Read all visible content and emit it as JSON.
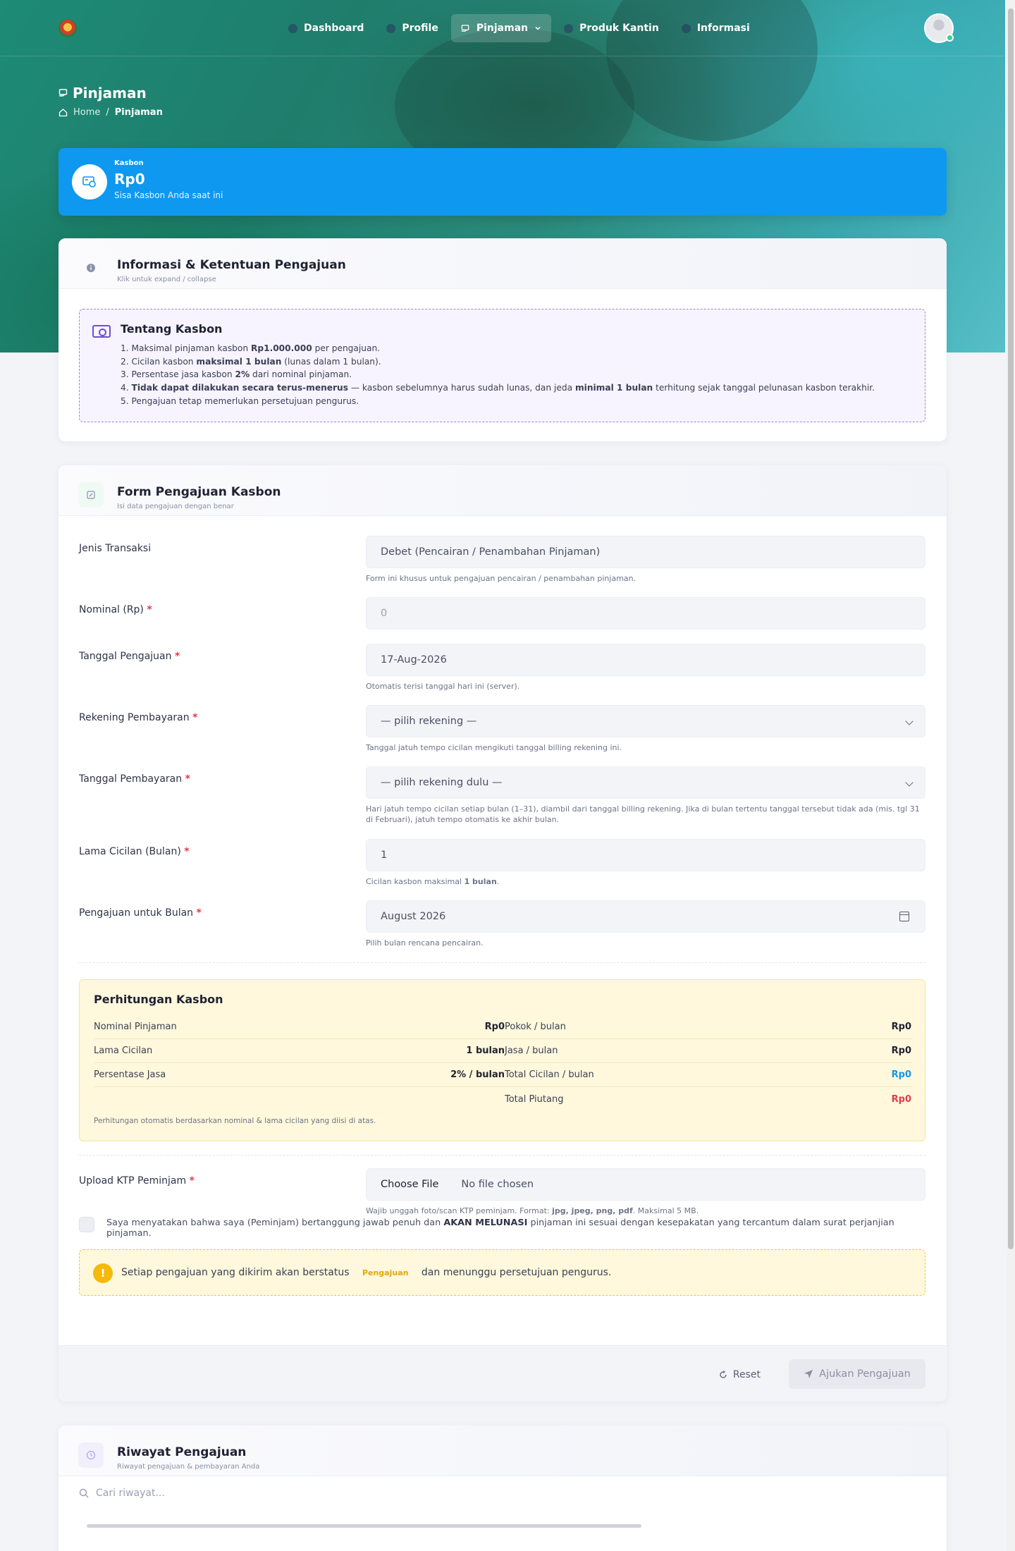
{
  "nav": {
    "items": [
      {
        "label": "Dashboard",
        "icon": "grid-icon"
      },
      {
        "label": "Profile",
        "icon": "user-icon"
      },
      {
        "label": "Pinjaman",
        "icon": "hand-money-icon",
        "active": true
      },
      {
        "label": "Produk Kantin",
        "icon": "store-icon"
      },
      {
        "label": "Informasi",
        "icon": "info-icon"
      }
    ]
  },
  "header": {
    "title": "Pinjaman",
    "breadcrumb": [
      "Home",
      "/",
      "Pinjaman"
    ]
  },
  "kasbon": {
    "label": "Kasbon",
    "value": "Rp0",
    "sub": "Sisa Kasbon Anda saat ini"
  },
  "info_card": {
    "title": "Informasi & Ketentuan Pengajuan",
    "sub": "Klik untuk expand / collapse",
    "box_title": "Tentang Kasbon",
    "items": [
      [
        "1. Maksimal pinjaman kasbon ",
        "Rp1.000.000",
        " per pengajuan."
      ],
      [
        "2. Cicilan kasbon ",
        "maksimal 1 bulan",
        " (lunas dalam 1 bulan)."
      ],
      [
        "3. Persentase jasa kasbon ",
        "2%",
        " dari nominal pinjaman."
      ],
      [
        "4. ",
        "Tidak dapat dilakukan secara terus-menerus",
        " — kasbon sebelumnya harus sudah lunas, dan jeda ",
        "minimal 1 bulan",
        " terhitung sejak tanggal pelunasan kasbon terakhir."
      ],
      [
        "5. Pengajuan tetap memerlukan persetujuan pengurus."
      ]
    ]
  },
  "form": {
    "title": "Form Pengajuan Kasbon",
    "sub": "Isi data pengajuan dengan benar",
    "jenis": {
      "label": "Jenis Transaksi",
      "value": "Debet (Pencairan / Penambahan Pinjaman)",
      "help": "Form ini khusus untuk pengajuan pencairan / penambahan pinjaman."
    },
    "nominal": {
      "label": "Nominal (Rp)",
      "placeholder": "0"
    },
    "tanggal": {
      "label": "Tanggal Pengajuan",
      "value": "17-Aug-2026",
      "help": "Otomatis terisi tanggal hari ini (server)."
    },
    "rekening": {
      "label": "Rekening Pembayaran",
      "value": "— pilih rekening —",
      "help": "Tanggal jatuh tempo cicilan mengikuti tanggal billing rekening ini."
    },
    "tgl_bayar": {
      "label": "Tanggal Pembayaran",
      "value": "— pilih rekening dulu —",
      "help": "Hari jatuh tempo cicilan setiap bulan (1–31), diambil dari tanggal billing rekening. Jika di bulan tertentu tanggal tersebut tidak ada (mis. tgl 31 di Februari), jatuh tempo otomatis ke akhir bulan."
    },
    "lama": {
      "label": "Lama Cicilan (Bulan)",
      "value": "1",
      "help_pre": "Cicilan kasbon maksimal ",
      "help_bold": "1 bulan",
      "help_post": "."
    },
    "bulan": {
      "label": "Pengajuan untuk Bulan",
      "value": "August 2026",
      "help": "Pilih bulan rencana pencairan."
    },
    "req_mark": "*"
  },
  "calc": {
    "title": "Perhitungan Kasbon",
    "left": [
      {
        "label": "Nominal Pinjaman",
        "value": "Rp0"
      },
      {
        "label": "Lama Cicilan",
        "value": "1 bulan"
      },
      {
        "label": "Persentase Jasa",
        "value": "2% / bulan"
      }
    ],
    "right": [
      {
        "label": "Pokok / bulan",
        "value": "Rp0"
      },
      {
        "label": "Jasa / bulan",
        "value": "Rp0"
      },
      {
        "label": "Total Cicilan / bulan",
        "value": "Rp0"
      },
      {
        "label": "Total Piutang",
        "value": "Rp0"
      }
    ],
    "note": "Perhitungan otomatis berdasarkan nominal & lama cicilan yang diisi di atas."
  },
  "upload": {
    "label": "Upload KTP Peminjam",
    "button": "Choose File",
    "status": "No file chosen",
    "help_pre": "Wajib unggah foto/scan KTP peminjam. Format: ",
    "help_bold": "jpg, jpeg, png, pdf",
    "help_post": ". Maksimal 5 MB."
  },
  "agreement": {
    "pre": "Saya menyatakan bahwa saya (Peminjam) bertanggung jawab penuh dan ",
    "bold": "AKAN MELUNASI",
    "post": " pinjaman ini sesuai dengan kesepakatan yang tercantum dalam surat perjanjian pinjaman."
  },
  "notice": {
    "icon": "!",
    "pre": "Setiap pengajuan yang dikirim akan berstatus",
    "badge": "Pengajuan",
    "post": "dan menunggu persetujuan pengurus."
  },
  "actions": {
    "reset": "Reset",
    "submit": "Ajukan Pengajuan"
  },
  "history": {
    "title": "Riwayat Pengajuan",
    "sub": "Riwayat pengajuan & pembayaran Anda",
    "search_placeholder": "Cari riwayat..."
  },
  "colors": {
    "primary": "#0e98f0",
    "danger": "#e23b4c",
    "warning": "#f5b90c",
    "hero": "#1d8b76"
  }
}
